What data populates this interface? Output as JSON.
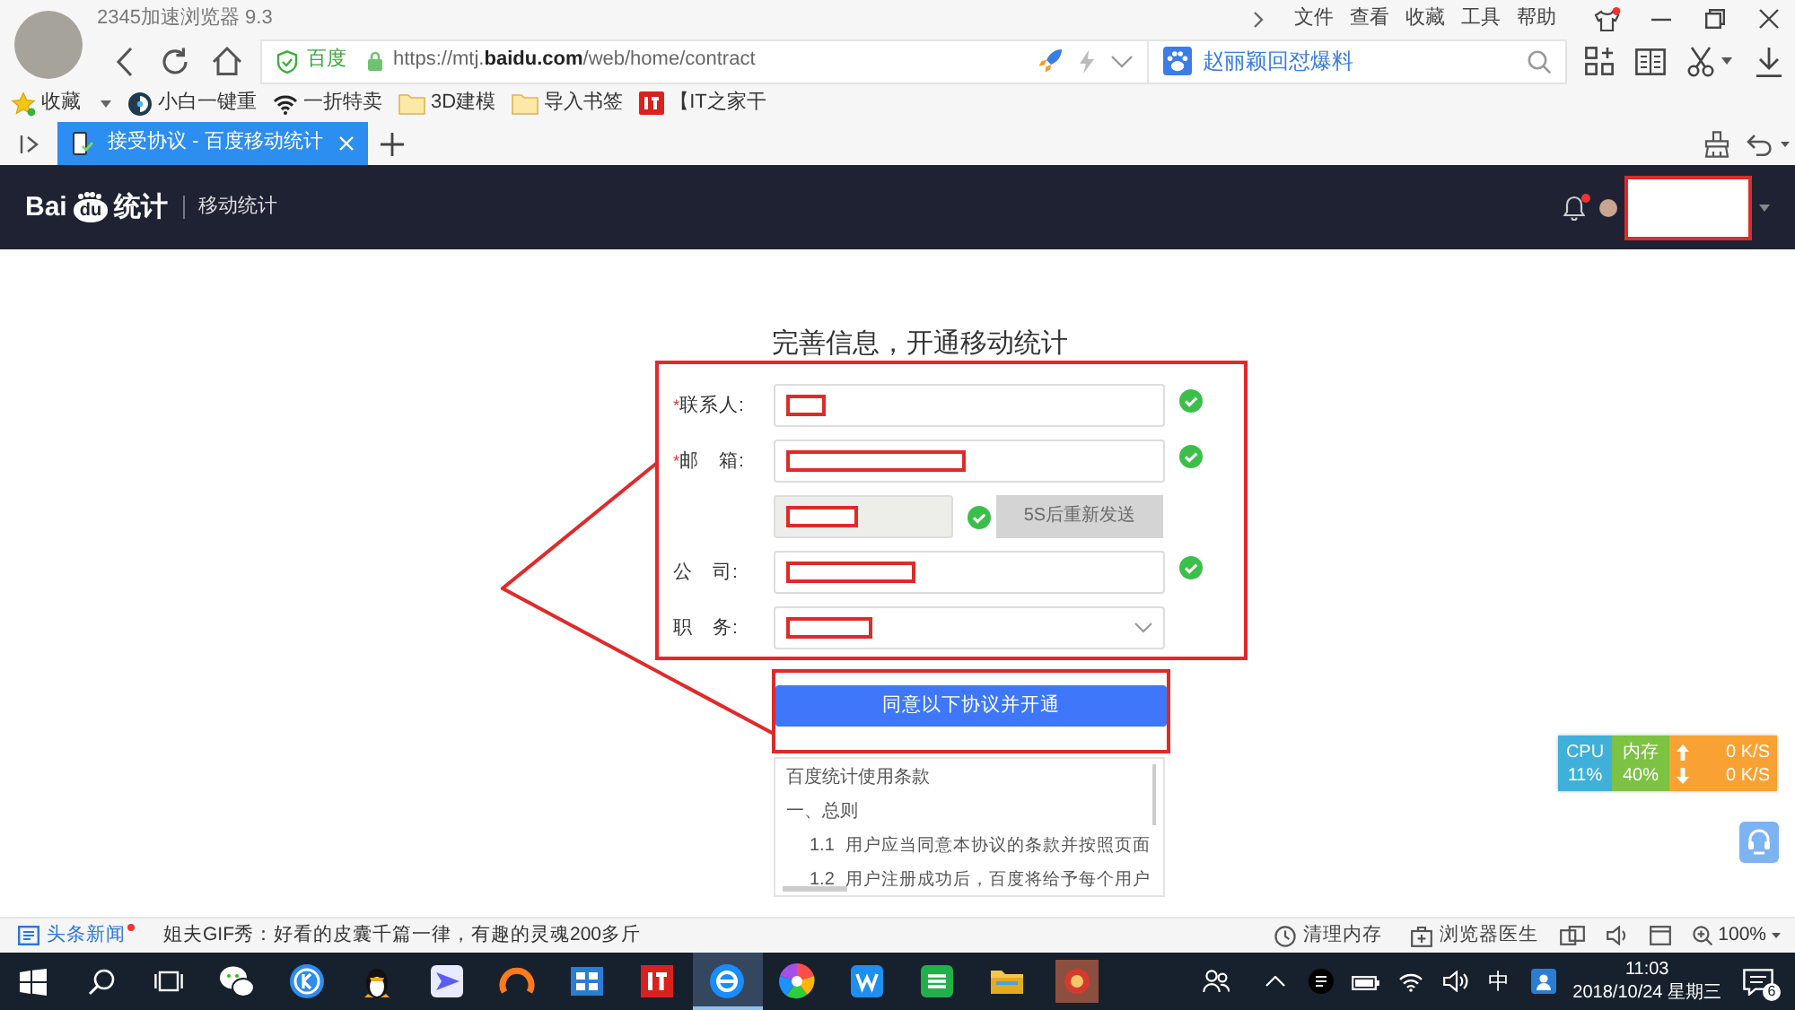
{
  "browser": {
    "title": "2345加速浏览器 9.3",
    "menu": [
      "文件",
      "查看",
      "收藏",
      "工具",
      "帮助"
    ],
    "address": {
      "site_badge": "百度",
      "url": "https://mtj.**baidu.com**/web/home/contract"
    },
    "hot_search": "赵丽颖回怼爆料"
  },
  "bookmarks": [
    {
      "kind": "menu",
      "label": "收藏"
    },
    {
      "kind": "link",
      "label": "小白一键重"
    },
    {
      "kind": "link",
      "label": "一折特卖"
    },
    {
      "kind": "folder",
      "label": "3D建模"
    },
    {
      "kind": "folder",
      "label": "导入书签"
    },
    {
      "kind": "link",
      "label": "【IT之家干"
    }
  ],
  "tabs": [
    {
      "label": "接受协议 - 百度移动统计",
      "selected": true
    }
  ],
  "site_header": {
    "logo_text": "Bai",
    "logo_mark": "du",
    "logo_product": "统计",
    "section": "移动统计",
    "notification": true,
    "user_redacted": true
  },
  "form": {
    "title": "完善信息，开通移动统计",
    "highlighted": true,
    "fields": [
      {
        "kind": "text",
        "required_mark": "*",
        "label": "联系人:",
        "redacted": true,
        "valid": true
      },
      {
        "kind": "text",
        "required_mark": "*",
        "label": "邮　箱:",
        "redacted": true,
        "valid": true
      },
      {
        "kind": "code",
        "redacted": true,
        "valid": true,
        "button": {
          "label": "5S后重新发送",
          "disabled": true
        }
      },
      {
        "kind": "text",
        "label": "公　司:",
        "redacted": true,
        "valid": true
      },
      {
        "kind": "select",
        "label": "职　务:",
        "redacted": true,
        "valid": false
      }
    ]
  },
  "submit": {
    "label": "同意以下协议并开通",
    "highlighted": true
  },
  "agreement": {
    "title": "百度统计使用条款",
    "section": "一、总则",
    "clauses": [
      {
        "number": "1.1",
        "text": "用户应当同意本协议的条款并按照页面"
      },
      {
        "number": "1.2",
        "text": "用户注册成功后，百度将给予每个用户"
      }
    ]
  },
  "monitor": {
    "cpu_label": "CPU",
    "cpu": "11%",
    "mem_label": "内存",
    "mem": "40%",
    "up": "0 K/S",
    "down": "0 K/S"
  },
  "status_bar": {
    "news_label": "头条新闻",
    "news_unread": true,
    "headline": "姐夫GIF秀：好看的皮囊千篇一律，有趣的灵魂200多斤",
    "actions": [
      "清理内存",
      "浏览器医生"
    ],
    "zoom": "100%"
  },
  "taskbar": {
    "apps": [
      {
        "active": false
      },
      {
        "active": false
      },
      {
        "active": false
      },
      {
        "active": false
      },
      {
        "active": false
      },
      {
        "active": false
      },
      {
        "active": false
      },
      {
        "active": true
      },
      {
        "active": false
      },
      {
        "active": false
      },
      {
        "active": false
      },
      {
        "active": false
      },
      {
        "active": false
      }
    ],
    "ime": "中",
    "time": "11:03",
    "date": "2018/10/24 星期三",
    "notifications": "6"
  }
}
